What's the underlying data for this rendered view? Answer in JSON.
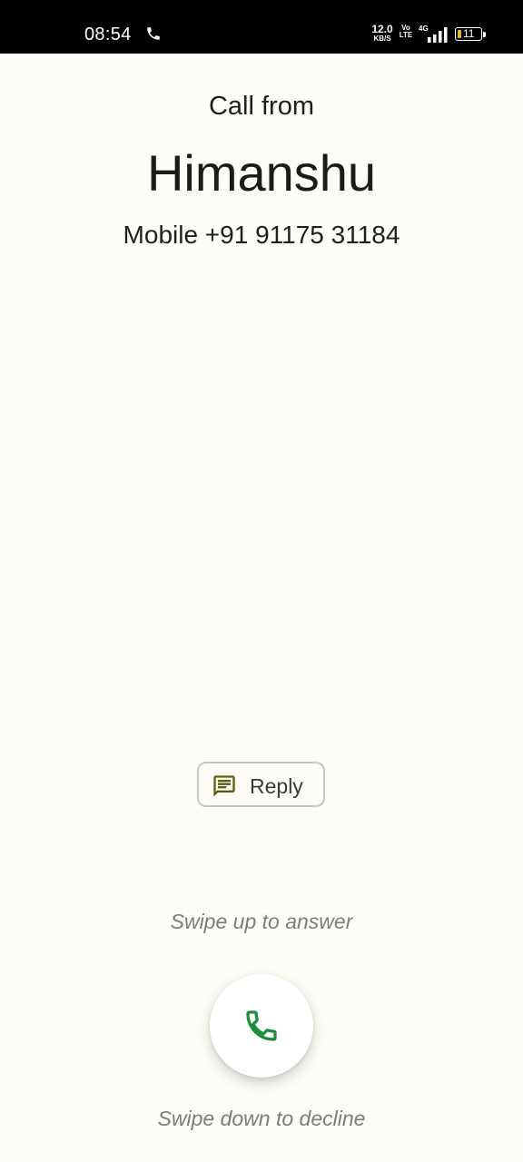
{
  "status_bar": {
    "time": "08:54",
    "call_icon": "phone-icon",
    "net_speed_value": "12.0",
    "net_speed_unit": "KB/S",
    "volte_top": "Vo",
    "volte_bottom": "LTE",
    "network_type": "4G",
    "battery_level": "11",
    "battery_color": "#e7b53a"
  },
  "call": {
    "header": "Call from",
    "caller_name": "Himanshu",
    "caller_number": "Mobile +91 91175 31184"
  },
  "actions": {
    "reply_label": "Reply",
    "reply_icon": "message-icon",
    "swipe_up_hint": "Swipe up to answer",
    "swipe_down_hint": "Swipe down to decline",
    "answer_icon": "phone-answer-icon"
  },
  "colors": {
    "background": "#fefcf6",
    "answer_icon": "#1e8e3e",
    "reply_icon": "#5b5f12",
    "hint_text": "#7c7c78"
  }
}
